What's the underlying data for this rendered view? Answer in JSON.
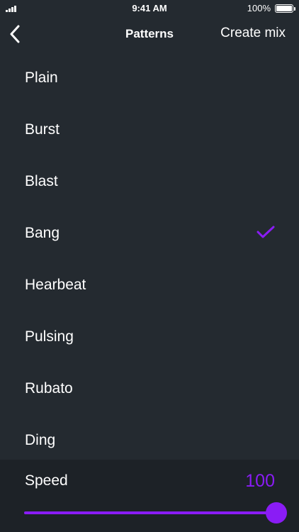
{
  "status_bar": {
    "time": "9:41 AM",
    "battery_percent": "100%",
    "battery_level": 1.0,
    "signal_icon": "cellular-signal-icon",
    "battery_icon": "battery-full-icon"
  },
  "nav": {
    "back_icon": "chevron-left-icon",
    "title": "Patterns",
    "action_label": "Create mix"
  },
  "patterns": {
    "items": [
      {
        "label": "Plain",
        "selected": false
      },
      {
        "label": "Burst",
        "selected": false
      },
      {
        "label": "Blast",
        "selected": false
      },
      {
        "label": "Bang",
        "selected": true
      },
      {
        "label": "Hearbeat",
        "selected": false
      },
      {
        "label": "Pulsing",
        "selected": false
      },
      {
        "label": "Rubato",
        "selected": false
      },
      {
        "label": "Ding",
        "selected": false
      }
    ],
    "selected_icon": "checkmark-icon"
  },
  "speed": {
    "label": "Speed",
    "value": "100",
    "level": 1.0
  },
  "colors": {
    "background": "#242a30",
    "panel": "#1d2227",
    "accent": "#8a1cf5",
    "text": "#ffffff"
  }
}
